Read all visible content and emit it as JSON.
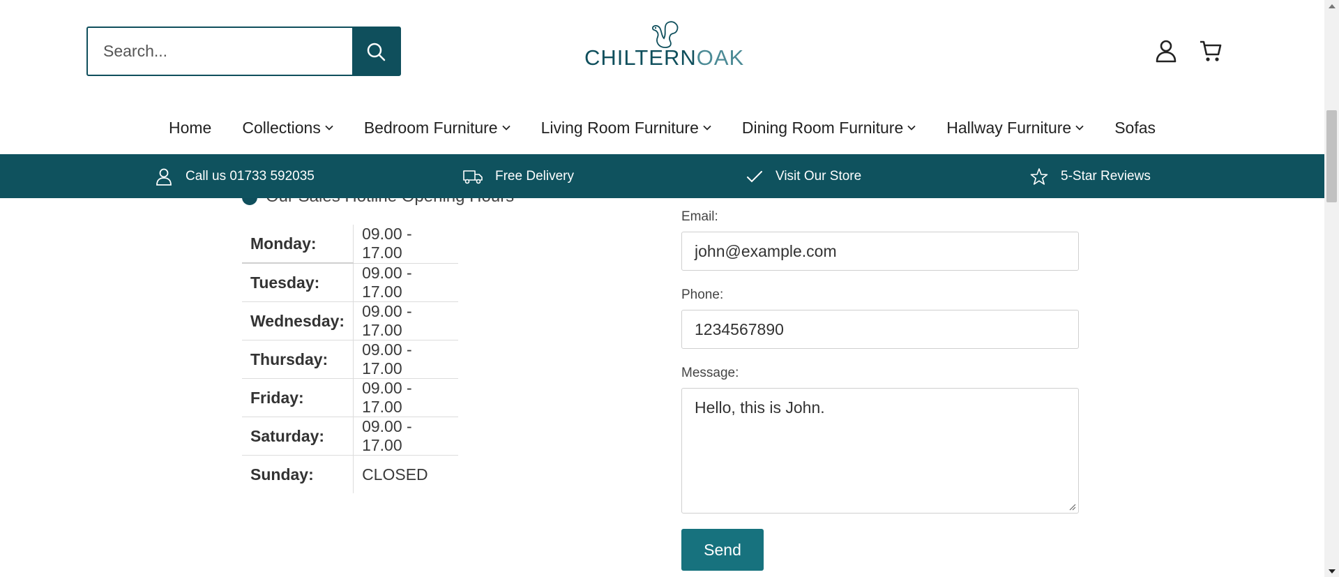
{
  "header": {
    "search": {
      "placeholder": "Search..."
    },
    "logo": {
      "text_part1": "CHILTERN",
      "text_part2": "OAK"
    },
    "account_icon": "user-icon",
    "cart_icon": "cart-icon"
  },
  "nav": {
    "items": [
      {
        "label": "Home",
        "has_dropdown": false
      },
      {
        "label": "Collections",
        "has_dropdown": true
      },
      {
        "label": "Bedroom Furniture",
        "has_dropdown": true
      },
      {
        "label": "Living Room Furniture",
        "has_dropdown": true
      },
      {
        "label": "Dining Room Furniture",
        "has_dropdown": true
      },
      {
        "label": "Hallway Furniture",
        "has_dropdown": true
      },
      {
        "label": "Sofas",
        "has_dropdown": false
      }
    ]
  },
  "usp_bar": {
    "items": [
      {
        "label": "Call us 01733 592035",
        "icon": "user-icon"
      },
      {
        "label": "Free Delivery",
        "icon": "truck-icon"
      },
      {
        "label": "Visit Our Store",
        "icon": "check-icon"
      },
      {
        "label": "5-Star Reviews",
        "icon": "star-icon"
      }
    ],
    "background": "#0f525e"
  },
  "hours": {
    "heading": "Our Sales Hotline Opening Hours",
    "rows": [
      {
        "day": "Monday:",
        "time": "09.00 - 17.00"
      },
      {
        "day": "Tuesday:",
        "time": "09.00 - 17.00"
      },
      {
        "day": "Wednesday:",
        "time": "09.00 - 17.00"
      },
      {
        "day": "Thursday:",
        "time": "09.00 - 17.00"
      },
      {
        "day": "Friday:",
        "time": "09.00 - 17.00"
      },
      {
        "day": "Saturday:",
        "time": "09.00 - 17.00"
      },
      {
        "day": "Sunday:",
        "time": "CLOSED"
      }
    ]
  },
  "form": {
    "email_label": "Email:",
    "email_value": "john@example.com",
    "phone_label": "Phone:",
    "phone_value": "1234567890",
    "message_label": "Message:",
    "message_value": "Hello, this is John.",
    "send_label": "Send"
  },
  "colors": {
    "brand_dark": "#0f4f5c",
    "button": "#17727e"
  }
}
